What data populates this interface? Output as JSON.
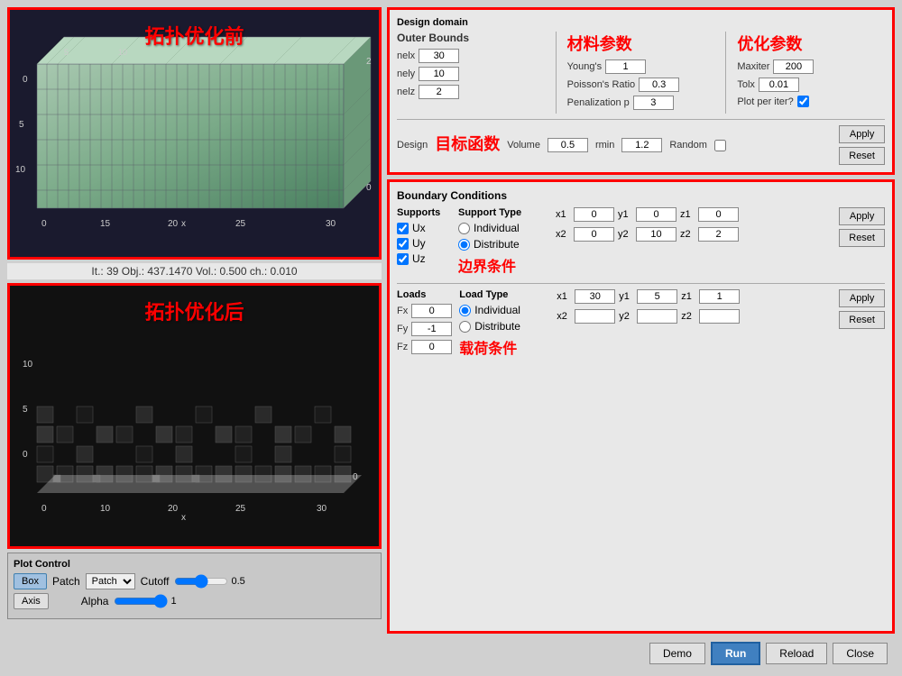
{
  "left": {
    "top_plot_label": "拓扑优化前",
    "bottom_plot_label": "拓扑优化后",
    "iter_info": "It.:  39  Obj.:  437.1470  Vol.:  0.500  ch.:  0.010",
    "plot_control": {
      "title": "Plot Control",
      "btn_box": "Box",
      "btn_axis": "Axis",
      "patch_label": "Patch",
      "cutoff_label": "Cutoff",
      "cutoff_value": "0.5",
      "alpha_label": "Alpha",
      "alpha_value": "1"
    }
  },
  "design_domain": {
    "title": "Design domain",
    "outer_bounds": {
      "title": "Outer Bounds",
      "nelx_label": "nelx",
      "nelx_value": "30",
      "nely_label": "nely",
      "nely_value": "10",
      "nelz_label": "nelz",
      "nelz_value": "2"
    },
    "material": {
      "title": "材料参数",
      "youngs_label": "Young's",
      "youngs_value": "1",
      "poisson_label": "Poisson's Ratio",
      "poisson_value": "0.3",
      "penal_label": "Penalization p",
      "penal_value": "3"
    },
    "optimization": {
      "title": "优化参数",
      "maxiter_label": "Maxiter",
      "maxiter_value": "200",
      "tolx_label": "Tolx",
      "tolx_value": "0.01",
      "plot_iter_label": "Plot per iter?"
    },
    "objective": {
      "title": "目标函数",
      "design_label": "Design",
      "volume_label": "Volume",
      "volume_value": "0.5",
      "rmin_label": "rmin",
      "rmin_value": "1.2",
      "random_label": "Random",
      "apply_label": "Apply",
      "reset_label": "Reset"
    }
  },
  "boundary_conditions": {
    "title": "Boundary Conditions",
    "supports": {
      "title": "Supports",
      "ux_label": "Ux",
      "uy_label": "Uy",
      "uz_label": "Uz",
      "support_type_label": "Support Type",
      "individual_label": "Individual",
      "distribute_label": "Distribute",
      "x1_label": "x1",
      "x1_value": "0",
      "y1_label": "y1",
      "y1_value": "0",
      "z1_label": "z1",
      "z1_value": "0",
      "x2_label": "x2",
      "x2_value": "0",
      "y2_label": "y2",
      "y2_value": "10",
      "z2_label": "z2",
      "z2_value": "2",
      "apply_label": "Apply",
      "reset_label": "Reset",
      "section_label": "边界条件"
    },
    "loads": {
      "title": "Loads",
      "section_label": "载荷条件",
      "fx_label": "Fx",
      "fx_value": "0",
      "fy_label": "Fy",
      "fy_value": "-1",
      "fz_label": "Fz",
      "fz_value": "0",
      "load_type_label": "Load Type",
      "individual_label": "Individual",
      "distribute_label": "Distribute",
      "x1_label": "x1",
      "x1_value": "30",
      "y1_label": "y1",
      "y1_value": "5",
      "z1_label": "z1",
      "z1_value": "1",
      "x2_label": "x2",
      "x2_value": "",
      "y2_label": "y2",
      "y2_value": "",
      "z2_label": "z2",
      "z2_value": "",
      "apply_label": "Apply",
      "reset_label": "Reset"
    }
  },
  "bottom_bar": {
    "demo_label": "Demo",
    "run_label": "Run",
    "reload_label": "Reload",
    "close_label": "Close"
  }
}
